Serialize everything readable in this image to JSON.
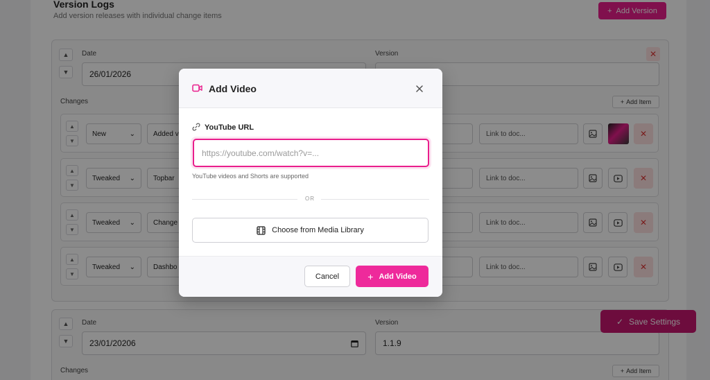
{
  "section": {
    "title": "Version Logs",
    "subtitle": "Add version releases with individual change items",
    "add_version_label": "Add Version"
  },
  "version1": {
    "date_label": "Date",
    "date_value": "26/01/2026",
    "version_label": "Version",
    "changes_label": "Changes",
    "add_item_label": "Add Item",
    "items": [
      {
        "type": "New",
        "text": "Added v",
        "link_placeholder": "Link to doc..."
      },
      {
        "type": "Tweaked",
        "text": "Topbar",
        "link_placeholder": "Link to doc..."
      },
      {
        "type": "Tweaked",
        "text": "Change",
        "link_placeholder": "Link to doc..."
      },
      {
        "type": "Tweaked",
        "text": "Dashbo",
        "link_placeholder": "Link to doc..."
      }
    ]
  },
  "version2": {
    "date_label": "Date",
    "date_value": "23/01/20206",
    "version_label": "Version",
    "version_value": "1.1.9",
    "changes_label": "Changes",
    "add_item_label": "Add Item"
  },
  "save_settings_label": "Save Settings",
  "modal": {
    "title": "Add Video",
    "url_label": "YouTube URL",
    "url_placeholder": "https://youtube.com/watch?v=...",
    "hint": "YouTube videos and Shorts are supported",
    "or_text": "OR",
    "media_library_label": "Choose from Media Library",
    "cancel_label": "Cancel",
    "add_video_label": "Add Video"
  },
  "colors": {
    "accent": "#e91e8c",
    "danger_bg": "#fde0e0",
    "danger": "#dd3333"
  }
}
